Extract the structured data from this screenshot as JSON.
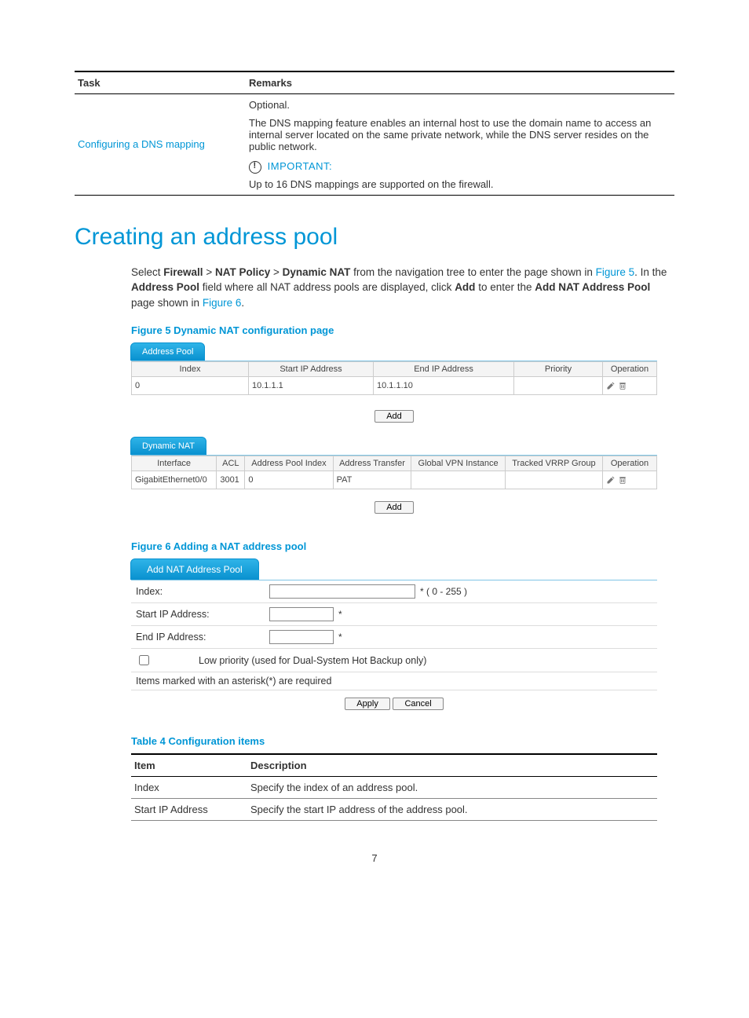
{
  "task_table": {
    "headers": [
      "Task",
      "Remarks"
    ],
    "task_link": "Configuring a DNS mapping",
    "remarks": {
      "optional": "Optional.",
      "desc": "The DNS mapping feature enables an internal host to use the domain name to access an internal server located on the same private network, while the DNS server resides on the public network.",
      "important_label": "IMPORTANT:",
      "important_text": "Up to 16 DNS mappings are supported on the firewall."
    }
  },
  "section_title": "Creating an address pool",
  "intro": {
    "part1": "Select ",
    "b1": "Firewall",
    "gt1": " > ",
    "b2": "NAT Policy",
    "gt2": " > ",
    "b3": "Dynamic NAT",
    "part2": " from the navigation tree to enter the page shown in ",
    "link1": "Figure 5",
    "part3": ". In the ",
    "b4": "Address Pool",
    "part4": " field where all NAT address pools are displayed, click ",
    "b5": "Add",
    "part5": " to enter the ",
    "b6": "Add NAT Address Pool",
    "part6": " page shown in ",
    "link2": "Figure 6",
    "part7": "."
  },
  "fig5_caption": "Figure 5 Dynamic NAT configuration page",
  "fig5": {
    "tab_ap": "Address Pool",
    "ap_headers": [
      "Index",
      "Start IP Address",
      "End IP Address",
      "Priority",
      "Operation"
    ],
    "ap_row": {
      "index": "0",
      "start": "10.1.1.1",
      "end": "10.1.1.10",
      "priority": ""
    },
    "add_btn": "Add",
    "tab_dn": "Dynamic NAT",
    "dn_headers": [
      "Interface",
      "ACL",
      "Address Pool Index",
      "Address Transfer",
      "Global VPN Instance",
      "Tracked VRRP Group",
      "Operation"
    ],
    "dn_row": {
      "iface": "GigabitEthernet0/0",
      "acl": "3001",
      "api": "0",
      "at": "PAT",
      "gvi": "",
      "tvg": ""
    }
  },
  "fig6_caption": "Figure 6 Adding a NAT address pool",
  "fig6": {
    "tab": "Add NAT Address Pool",
    "rows": {
      "index_label": "Index:",
      "index_hint": "* ( 0 - 255 )",
      "start_label": "Start IP Address:",
      "end_label": "End IP Address:",
      "checkbox_label": "Low priority (used for Dual-System Hot Backup only)"
    },
    "note": "Items marked with an asterisk(*) are required",
    "apply": "Apply",
    "cancel": "Cancel"
  },
  "table4_caption": "Table 4 Configuration items",
  "table4": {
    "headers": [
      "Item",
      "Description"
    ],
    "rows": [
      {
        "item": "Index",
        "desc": "Specify the index of an address pool."
      },
      {
        "item": "Start IP Address",
        "desc": "Specify the start IP address of the address pool."
      }
    ]
  },
  "page_number": "7"
}
